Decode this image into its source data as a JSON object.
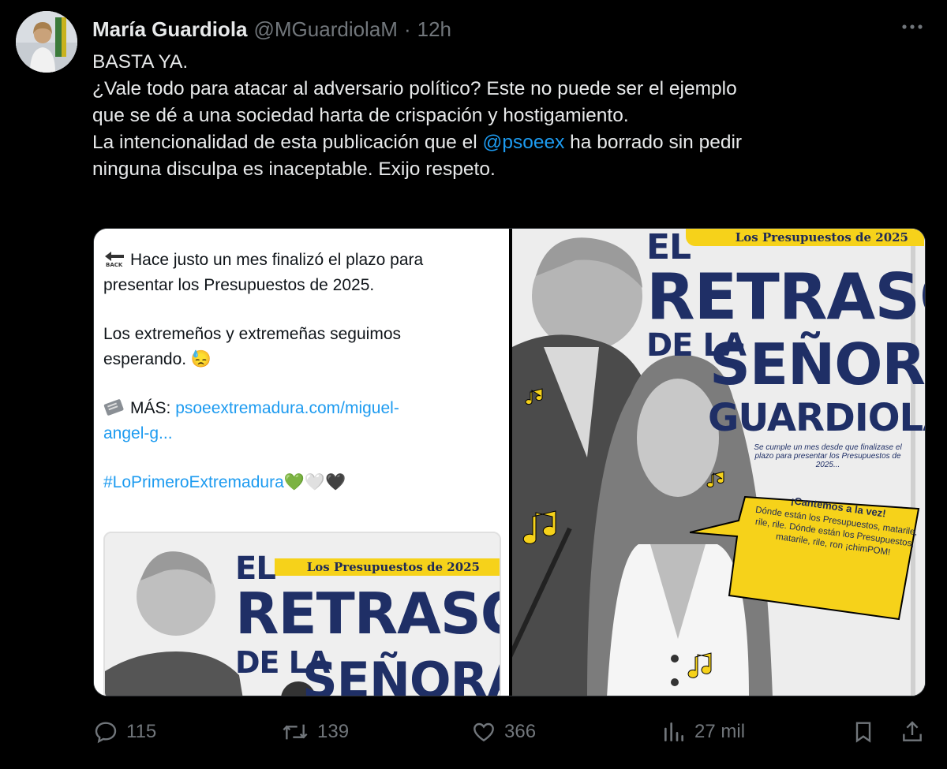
{
  "tweet": {
    "author_name": "María Guardiola",
    "handle": "@MGuardiolaM",
    "separator": "·",
    "time": "12h",
    "line1": "BASTA YA.",
    "line2": "¿Vale todo para atacar al adversario político? Este no puede ser el ejemplo",
    "line3": "que se dé a una sociedad harta de crispación y hostigamiento.",
    "line4_pre": "La intencionalidad de esta publicación que el ",
    "line4_mention": "@psoeex",
    "line4_post": " ha borrado sin pedir",
    "line5": "ninguna disculpa es inaceptable. Exijo respeto."
  },
  "embedded": {
    "line1": "Hace justo un mes finalizó el plazo para",
    "line2": "presentar los Presupuestos de 2025.",
    "line3": "Los extremeños y extremeñas seguimos",
    "line4": "esperando. 😓",
    "more_label": "MÁS: ",
    "link1": "psoeextremadura.com/miguel-",
    "link2": "angel-g...",
    "hashtag": "#LoPrimeroExtremadura",
    "hearts": "💚🤍🖤"
  },
  "poster": {
    "banner": "Los Presupuestos de 2025",
    "el": "EL",
    "retraso": "RETRASO",
    "de_la": "DE LA",
    "senora": "SEÑORA",
    "guardiola": "GUARDIOLA",
    "subtitle": "Se cumple un mes desde que finalizase el plazo para presentar los Presupuestos de 2025...",
    "speech_title": "¡Cantemos a la vez!",
    "speech_body": "Dónde están los Presupuestos, matarile, rile, rile. Dónde están los Presupuestos, matarile, rile, ron ¡chimPOM!"
  },
  "actions": {
    "replies": "115",
    "reposts": "139",
    "likes": "366",
    "views": "27 mil"
  },
  "colors": {
    "link": "#1d9bf0",
    "banner_yellow": "#f6d21a",
    "poster_navy": "#1f2f66",
    "muted": "#71767b"
  }
}
